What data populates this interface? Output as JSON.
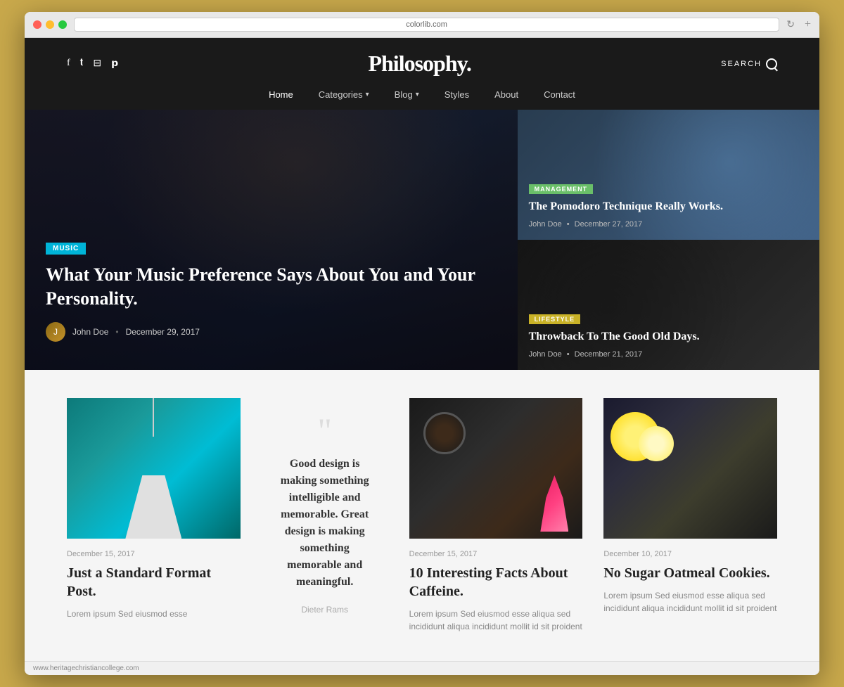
{
  "browser": {
    "url": "colorlib.com",
    "refresh_icon": "↻",
    "add_tab_icon": "+"
  },
  "header": {
    "logo": "Philosophy.",
    "search_label": "SEARCH",
    "social_links": [
      {
        "icon": "f",
        "name": "facebook"
      },
      {
        "icon": "𝕥",
        "name": "twitter"
      },
      {
        "icon": "⊡",
        "name": "instagram"
      },
      {
        "icon": "𝗽",
        "name": "pinterest"
      }
    ]
  },
  "nav": {
    "items": [
      {
        "label": "Home",
        "active": true,
        "has_dropdown": false
      },
      {
        "label": "Categories",
        "active": false,
        "has_dropdown": true
      },
      {
        "label": "Blog",
        "active": false,
        "has_dropdown": true
      },
      {
        "label": "Styles",
        "active": false,
        "has_dropdown": false
      },
      {
        "label": "About",
        "active": false,
        "has_dropdown": false
      },
      {
        "label": "Contact",
        "active": false,
        "has_dropdown": false
      }
    ]
  },
  "hero": {
    "main_post": {
      "tag": "MUSIC",
      "title": "What Your Music Preference Says About You and Your Personality.",
      "author": "John Doe",
      "date": "December 29, 2017"
    },
    "side_posts": [
      {
        "tag": "MANAGEMENT",
        "title": "The Pomodoro Technique Really Works.",
        "author": "John Doe",
        "date": "December 27, 2017"
      },
      {
        "tag": "LIFESTYLE",
        "title": "Throwback To The Good Old Days.",
        "author": "John Doe",
        "date": "December 21, 2017"
      }
    ]
  },
  "content": {
    "posts": [
      {
        "type": "standard",
        "date": "December 15, 2017",
        "title": "Just a Standard Format Post.",
        "excerpt": "Lorem ipsum Sed eiusmod esse"
      },
      {
        "type": "quote",
        "text": "Good design is making something intelligible and memorable. Great design is making something memorable and meaningful.",
        "author": "Dieter Rams"
      },
      {
        "type": "image",
        "date": "December 15, 2017",
        "title": "10 Interesting Facts About Caffeine.",
        "excerpt": "Lorem ipsum Sed eiusmod esse aliqua sed incididunt aliqua incididunt mollit id sit proident"
      },
      {
        "type": "image",
        "date": "December 10, 2017",
        "title": "No Sugar Oatmeal Cookies.",
        "excerpt": "Lorem ipsum Sed eiusmod esse aliqua sed incididunt aliqua incididunt mollit id sit proident"
      }
    ]
  },
  "status_bar": {
    "url": "www.heritagechristiancollege.com"
  }
}
